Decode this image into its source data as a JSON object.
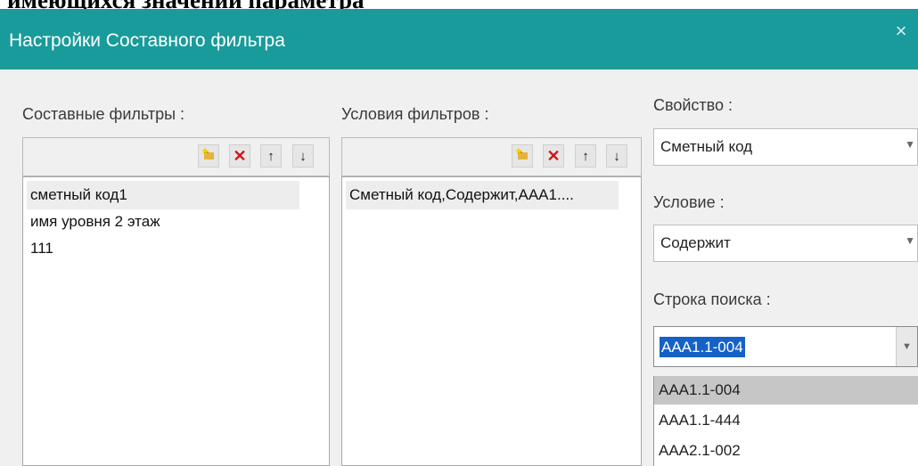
{
  "doc": {
    "heading": "имеющихся значений параметра"
  },
  "dialog": {
    "title": "Настройки Составного фильтра",
    "close_glyph": "×",
    "composite": {
      "label": "Составные фильтры :",
      "items": [
        "сметный код1",
        "имя уровня 2 этаж",
        "111"
      ]
    },
    "conditions": {
      "label": "Условия фильтров :",
      "items": [
        "Сметный код,Содержит,ААА1...."
      ]
    },
    "toolbar_icons": [
      "add-filter-icon",
      "delete-icon",
      "arrow-up-icon",
      "arrow-down-icon"
    ],
    "property": {
      "label": "Свойство :",
      "value": "Сметный код"
    },
    "condition": {
      "label": "Условие :",
      "value": "Содержит"
    },
    "search": {
      "label": "Строка поиска :",
      "value": "AAA1.1-004",
      "options": [
        "AAA1.1-004",
        "AAA1.1-444",
        "AAA2.1-002"
      ]
    }
  },
  "colors": {
    "titlebar": "#1a9b9b",
    "selection": "#1561c8",
    "delete": "#d01818"
  }
}
